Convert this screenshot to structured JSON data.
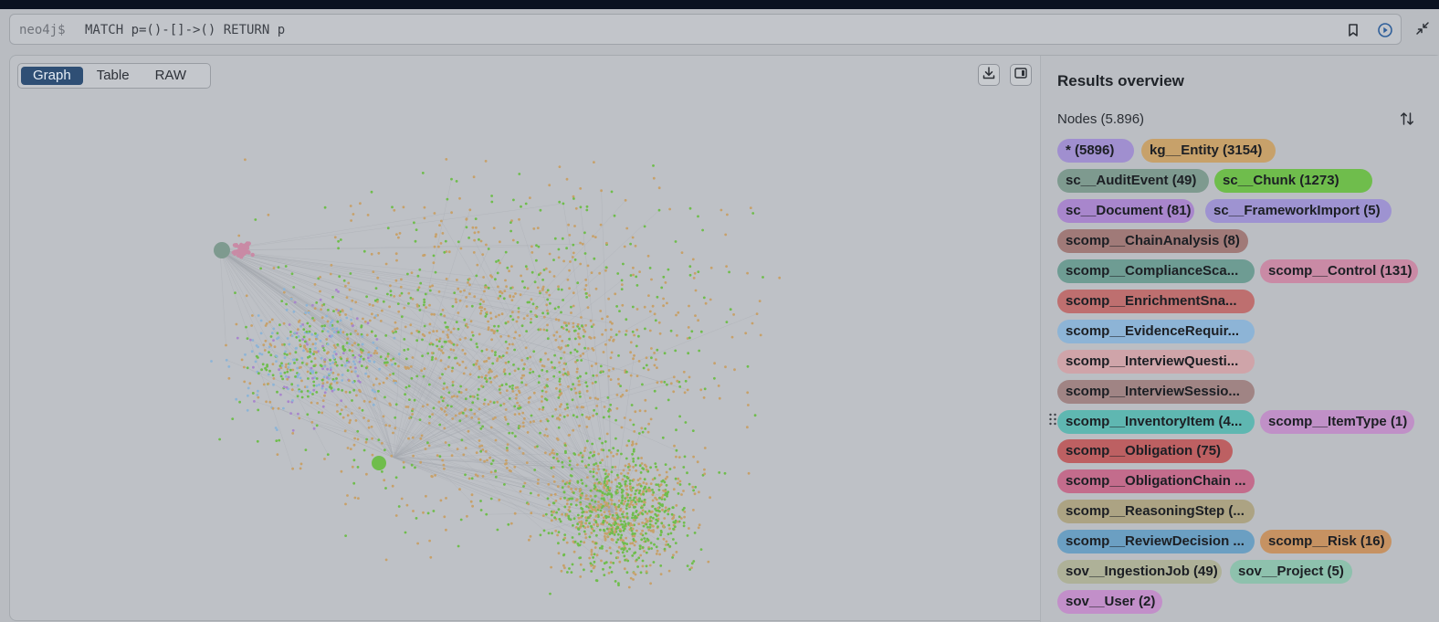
{
  "editor": {
    "prompt": "neo4j$",
    "query": "MATCH p=()-[]->() RETURN p",
    "icons": [
      "bookmark-icon",
      "run-icon",
      "collapse-icon"
    ]
  },
  "view_tabs": [
    "Graph",
    "Table",
    "RAW"
  ],
  "active_tab": "Graph",
  "toolbar_icons": [
    "download-icon",
    "panel-toggle-icon"
  ],
  "results": {
    "title": "Results overview",
    "nodes_label": "Nodes (5.896)",
    "labels": [
      {
        "text": "* (5896)",
        "color": "#a08fcf"
      },
      {
        "text": "kg__Entity (3154)",
        "color": "#c7a16a"
      },
      {
        "text": "sc__AuditEvent (49)",
        "color": "#7e9a8f"
      },
      {
        "text": "sc__Chunk (1273)",
        "color": "#6fbd4c"
      },
      {
        "text": "sc__Document (81)",
        "color": "#a886cc"
      },
      {
        "text": "sc__FrameworkImport (5)",
        "color": "#9e93d1"
      },
      {
        "text": "scomp__ChainAnalysis (8)",
        "color": "#a07a78"
      },
      {
        "text": "scomp__ComplianceSca...",
        "color": "#6e9c93"
      },
      {
        "text": "scomp__Control (131)",
        "color": "#c98aa5"
      },
      {
        "text": "scomp__EnrichmentSna...",
        "color": "#be6f6f"
      },
      {
        "text": "scomp__EvidenceRequir...",
        "color": "#8db4d6"
      },
      {
        "text": "scomp__InterviewQuesti...",
        "color": "#cfa4a9"
      },
      {
        "text": "scomp__InterviewSessio...",
        "color": "#a08484"
      },
      {
        "text": "scomp__InventoryItem (4...",
        "color": "#5fb7b1"
      },
      {
        "text": "scomp__ItemType (1)",
        "color": "#c090c7"
      },
      {
        "text": "scomp__Obligation (75)",
        "color": "#bd6062"
      },
      {
        "text": "scomp__ObligationChain ...",
        "color": "#c36c8c"
      },
      {
        "text": "scomp__ReasoningStep (...",
        "color": "#aca383"
      },
      {
        "text": "scomp__ReviewDecision ...",
        "color": "#6b9fc2"
      },
      {
        "text": "scomp__Risk (16)",
        "color": "#c69262"
      },
      {
        "text": "sov__IngestionJob (49)",
        "color": "#aeb198"
      },
      {
        "text": "sov__Project (5)",
        "color": "#8ec1ad"
      },
      {
        "text": "sov__User (2)",
        "color": "#c28fc9"
      }
    ]
  },
  "graph_colors": {
    "entity": "#c7a16a",
    "chunk": "#6fbd4c",
    "evidence": "#8db4d6",
    "control": "#c98aa5",
    "audit": "#7e9a8f",
    "document": "#a886cc",
    "edge": "#a4a8ae"
  }
}
